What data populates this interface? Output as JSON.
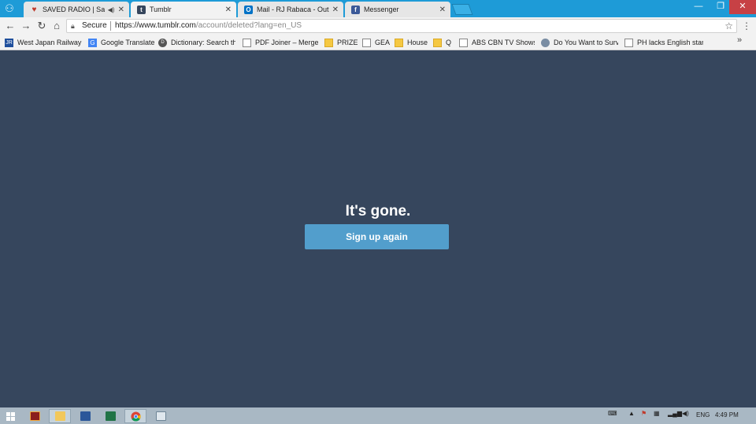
{
  "browser": {
    "tabs": [
      {
        "title": "SAVED RADIO | Saved",
        "favicon": "heart-icon",
        "audio": true
      },
      {
        "title": "Tumblr",
        "favicon": "tumblr-icon",
        "active": true
      },
      {
        "title": "Mail - RJ Rabaca - Outloo",
        "favicon": "outlook-icon"
      },
      {
        "title": "Messenger",
        "favicon": "facebook-icon"
      }
    ],
    "address": {
      "secure_label": "Secure",
      "url_host": "https://www.tumblr.com",
      "url_path": "/account/deleted?lang=en_US"
    },
    "bookmarks": [
      {
        "label": "West Japan Railway C",
        "icon": "jr-west-icon"
      },
      {
        "label": "Google Translate",
        "icon": "google-translate-icon"
      },
      {
        "label": "Dictionary: Search the",
        "icon": "dictionary-icon"
      },
      {
        "label": "PDF Joiner – Merge P",
        "icon": "page-icon"
      },
      {
        "label": "PRIZE",
        "icon": "folder-icon"
      },
      {
        "label": "GEA",
        "icon": "page-icon"
      },
      {
        "label": "House",
        "icon": "folder-icon"
      },
      {
        "label": "Q",
        "icon": "folder-icon"
      },
      {
        "label": "ABS CBN TV Shows |",
        "icon": "page-icon"
      },
      {
        "label": "Do You Want to Surv",
        "icon": "site-icon"
      },
      {
        "label": "PH lacks English stan",
        "icon": "page-icon"
      }
    ],
    "bookmarks_more": "»"
  },
  "page": {
    "heading": "It's gone.",
    "button_label": "Sign up again"
  },
  "taskbar": {
    "language": "ENG",
    "time": "4:49 PM"
  },
  "colors": {
    "background": "#36465d",
    "button": "#529ecc",
    "titlebar": "#1e9bd7"
  }
}
